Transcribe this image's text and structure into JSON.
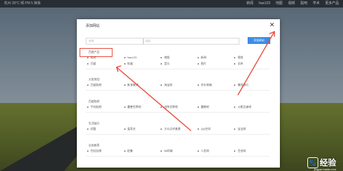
{
  "topbar": {
    "weather": "杭州  28°C 晴  PM  5  换肤",
    "nav": [
      "新闻",
      "hao123",
      "地图",
      "视频",
      "贴吧",
      "学术",
      "更多产品"
    ]
  },
  "modal": {
    "title": "添加网站",
    "name_placeholder": "名称",
    "url_placeholder": "网址",
    "add_label": "添加网站",
    "sections": [
      {
        "title": "百度产品",
        "items": [
          "贴吧",
          "hao123",
          "地图",
          "新闻",
          "视频",
          "百度",
          "知道",
          "音乐",
          "图片",
          "文库"
        ]
      },
      {
        "title": "大家常用",
        "items": [
          "百度贴吧",
          "新浪微博",
          "淘宝网",
          "京东商城",
          "携程旅行"
        ]
      },
      {
        "title": "百度贴吧",
        "items": [
          "手机贴吧",
          "魔兽世界吧",
          "战争世界吧",
          "魔兽吧",
          "火影忍者吧"
        ]
      },
      {
        "title": "生活娱乐",
        "items": [
          "优酷",
          "爱奇艺",
          "大众点评美食",
          "QQ空间",
          "宝宝树"
        ]
      },
      {
        "title": "业务推荐",
        "items": [
          "世纪佳缘",
          "赶集",
          "58同城",
          "人民网",
          "百合网"
        ]
      }
    ]
  },
  "watermark": {
    "text": "经验",
    "sub": "jingyan.baidu.com"
  }
}
